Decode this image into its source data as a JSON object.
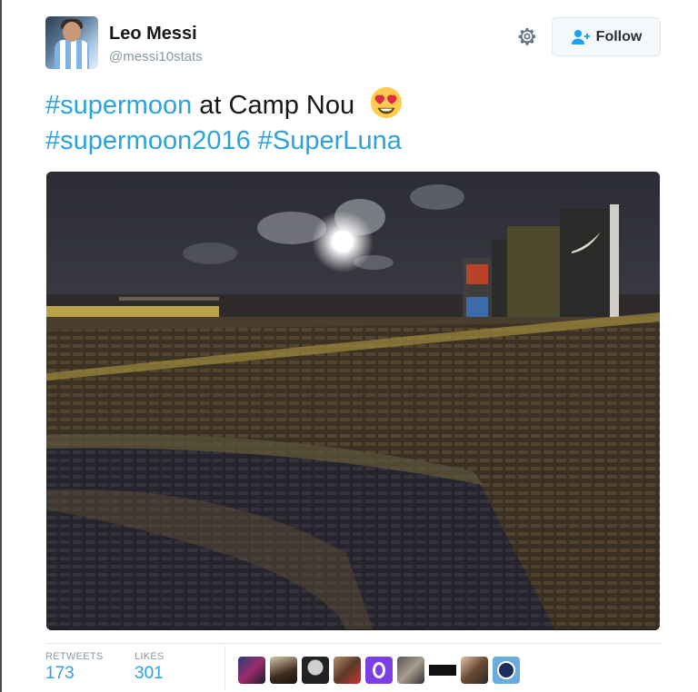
{
  "user": {
    "name": "Leo Messi",
    "handle": "@messi10stats"
  },
  "actions": {
    "follow_label": "Follow"
  },
  "tweet": {
    "tag1": "#supermoon",
    "text1": " at Camp Nou",
    "tag2": "#supermoon2016",
    "tag3": "#SuperLuna",
    "emoji": "heart-eyes-emoji"
  },
  "stats": {
    "retweets_label": "RETWEETS",
    "retweets_value": "173",
    "likes_label": "LIKES",
    "likes_value": "301"
  },
  "colors": {
    "hashtag": "#2aa3df",
    "follow_bg": "#f5f8fa",
    "muted": "#8899a6"
  },
  "icons": [
    "gear-icon",
    "follow-person-plus-icon"
  ]
}
